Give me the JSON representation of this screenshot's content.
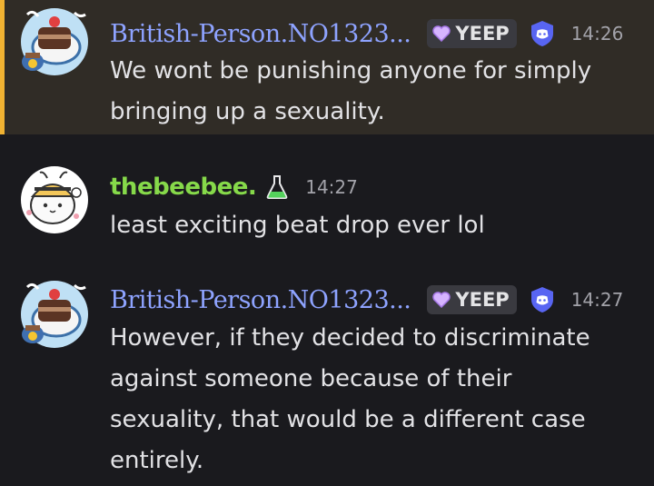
{
  "messages": [
    {
      "author": "British-Person.NO1323...",
      "tag": "YEEP",
      "time": "14:26",
      "lines": [
        "We wont be punishing anyone for simply",
        "bringing up a sexuality."
      ],
      "name_color": "#8ea3ff",
      "highlighted": true
    },
    {
      "author": "thebeebee.",
      "time": "14:27",
      "lines": [
        "least exciting beat drop ever lol"
      ],
      "name_color": "#86d94a",
      "badge_icon": "flask-icon"
    },
    {
      "author": "British-Person.NO1323...",
      "tag": "YEEP",
      "time": "14:27",
      "lines": [
        "However, if they decided to discriminate",
        "against someone because of their",
        "sexuality, that would be a different case",
        "entirely."
      ],
      "name_color": "#8ea3ff"
    }
  ],
  "colors": {
    "background": "#1a1a1e",
    "highlight_bg": "#302c26",
    "highlight_bar": "#f0b232",
    "tag_bg": "#3a3a40",
    "shield": "#5865f2"
  }
}
